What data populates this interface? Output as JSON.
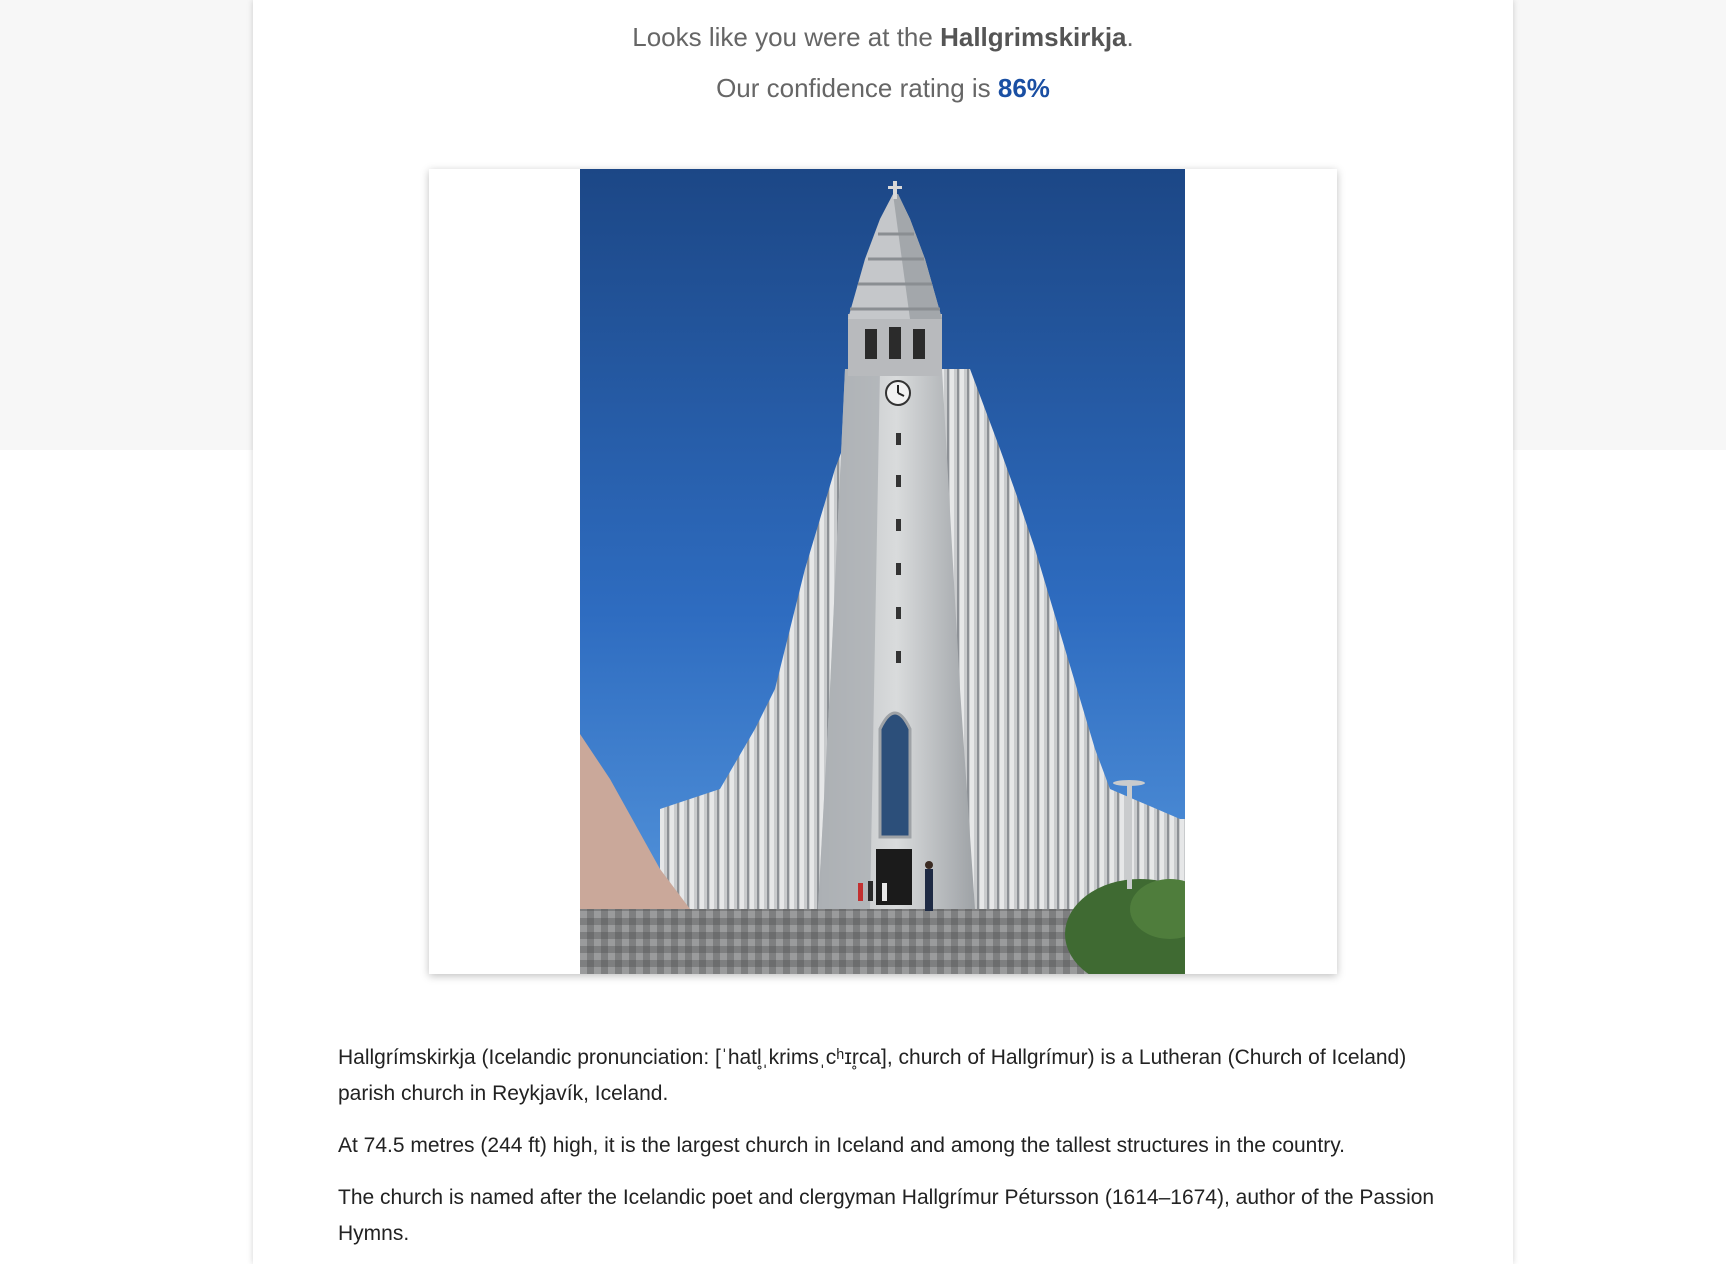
{
  "result": {
    "prefix": "Looks like you were at the ",
    "place": "Hallgrimskirkja",
    "suffix": ".",
    "confidence_prefix": "Our confidence rating is ",
    "confidence_value": "86%"
  },
  "colors": {
    "accent": "#1a4fa3",
    "text_muted": "#666666",
    "sky_top": "#1c4786",
    "sky_bottom": "#4a8fd8"
  },
  "photo": {
    "subject": "Hallgrímskirkja church tower"
  },
  "description": {
    "paragraphs": [
      "Hallgrímskirkja (Icelandic pronunciation: [ˈhatl̥ˌkrimsˌcʰɪr̥ca], church of Hallgrímur) is a Lutheran (Church of Iceland) parish church in Reykjavík, Iceland.",
      "At 74.5 metres (244 ft) high, it is the largest church in Iceland and among the tallest structures in the country.",
      "The church is named after the Icelandic poet and clergyman Hallgrímur Pétursson (1614–1674), author of the Passion Hymns."
    ]
  }
}
